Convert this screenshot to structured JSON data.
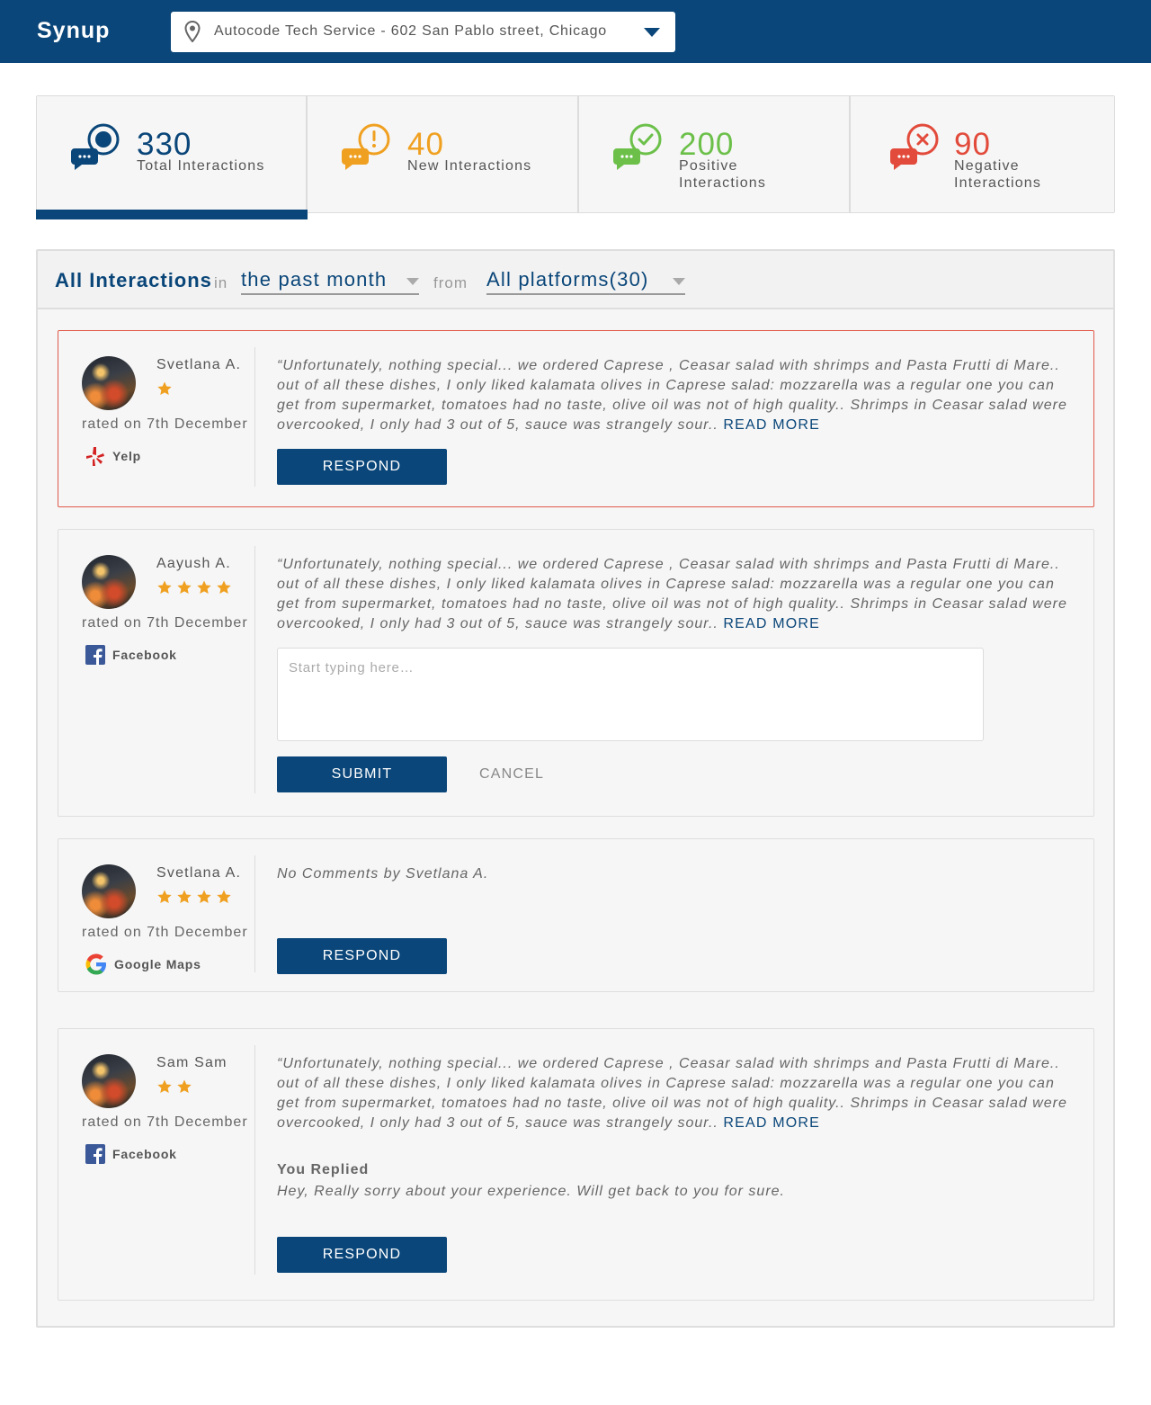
{
  "header": {
    "brand": "Synup",
    "location": "Autocode Tech Service - 602 San Pablo street, Chicago"
  },
  "stats": [
    {
      "value": "330",
      "label": "Total Interactions",
      "color": "#0a4679",
      "icon": "chat-dot-icon"
    },
    {
      "value": "40",
      "label": "New Interactions",
      "color": "#f0a020",
      "icon": "chat-alert-icon"
    },
    {
      "value": "200",
      "label": "Positive Interactions",
      "color": "#6cc04a",
      "icon": "chat-check-icon"
    },
    {
      "value": "90",
      "label": "Negative Interactions",
      "color": "#e24b3b",
      "icon": "chat-x-icon"
    }
  ],
  "filter": {
    "title": "All Interactions",
    "in_word": "in",
    "period": "the past month",
    "from_word": "from",
    "platforms": "All platforms(30)"
  },
  "reviews": [
    {
      "name": "Svetlana A.",
      "stars": 1,
      "rated": "rated on 7th December",
      "platform": "Yelp",
      "text": "“Unfortunately, nothing special... we ordered Caprese , Ceasar salad with shrimps and Pasta Frutti di Mare.. out of all these dishes, I only liked kalamata olives in Caprese salad: mozzarella was a regular one you can get from supermarket, tomatoes had no taste, olive oil was not of high quality.. Shrimps in Ceasar salad were overcooked, I only had 3 out of 5, sauce was strangely sour..",
      "read_more": "READ MORE",
      "button": "RESPOND"
    },
    {
      "name": "Aayush A.",
      "stars": 4,
      "rated": "rated on 7th December",
      "platform": "Facebook",
      "text": "“Unfortunately, nothing special... we ordered Caprese , Ceasar salad with shrimps and Pasta Frutti di Mare.. out of all these dishes, I only liked kalamata olives in Caprese salad: mozzarella was a regular one you can get from supermarket, tomatoes had no taste, olive oil was not of high quality.. Shrimps in Ceasar salad were overcooked, I only had 3 out of 5, sauce was strangely sour..",
      "read_more": "READ MORE",
      "reply_placeholder": "Start typing here…",
      "submit": "SUBMIT",
      "cancel": "CANCEL"
    },
    {
      "name": "Svetlana A.",
      "stars": 4,
      "rated": "rated on 7th December",
      "platform": "Google Maps",
      "text": "No Comments by Svetlana A.",
      "button": "RESPOND"
    },
    {
      "name": "Sam Sam",
      "stars": 2,
      "rated": "rated on 7th December",
      "platform": "Facebook",
      "text": "“Unfortunately, nothing special... we ordered Caprese , Ceasar salad with shrimps and Pasta Frutti di Mare.. out of all these dishes, I only liked kalamata olives in Caprese salad: mozzarella was a regular one you can get from supermarket, tomatoes had no taste, olive oil was not of high quality.. Shrimps in Ceasar salad were overcooked, I only had 3 out of 5, sauce was strangely sour..",
      "read_more": "READ MORE",
      "replied_label": "You Replied",
      "replied_text": "Hey, Really sorry about your experience. Will get back to you for sure.",
      "button": "RESPOND"
    }
  ]
}
